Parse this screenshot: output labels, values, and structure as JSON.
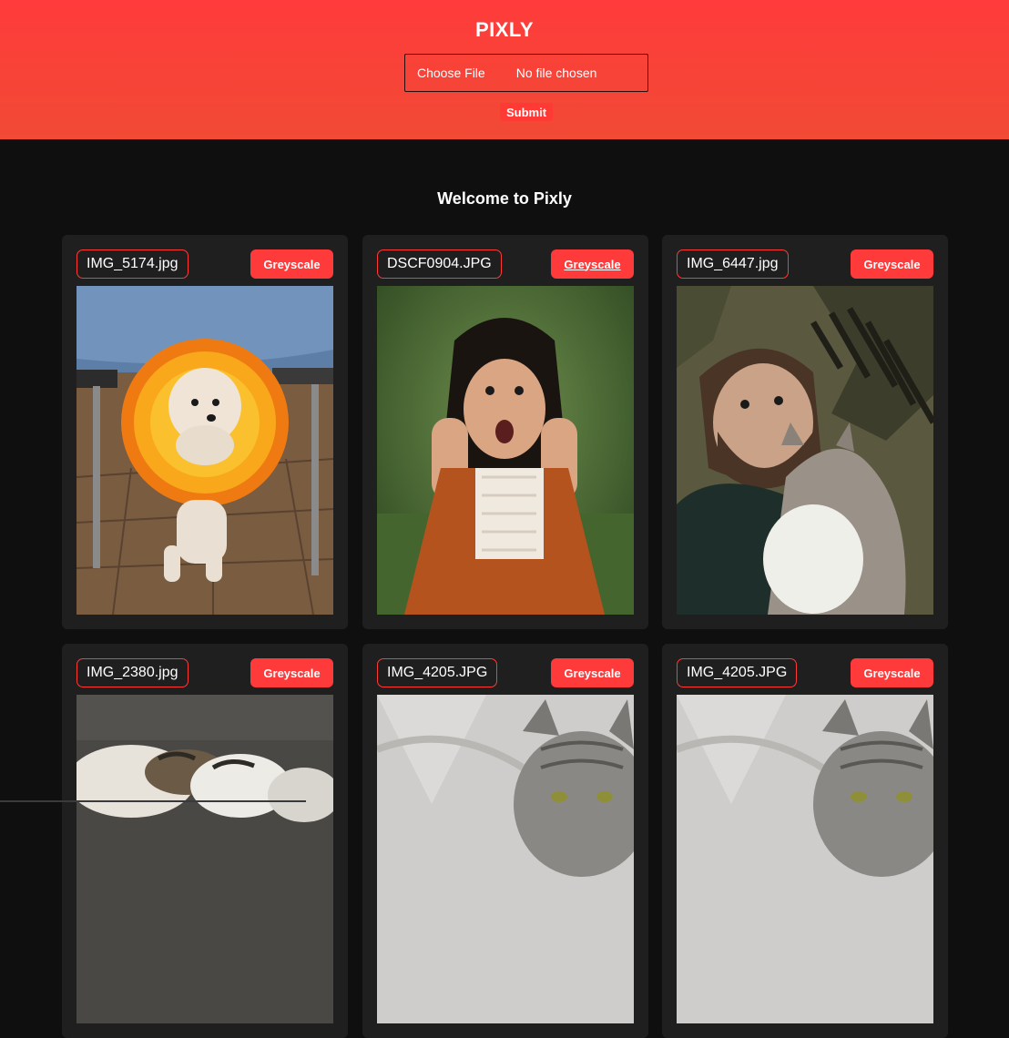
{
  "header": {
    "title": "PIXLY",
    "file_button_label": "Choose File",
    "file_status": "No file chosen",
    "submit_label": "Submit"
  },
  "main": {
    "welcome": "Welcome to Pixly",
    "cards": [
      {
        "file_name": "IMG_5174.jpg",
        "button_label": "Greyscale",
        "image": "poodle-with-flower-cone"
      },
      {
        "file_name": "DSCF0904.JPG",
        "button_label": "Greyscale",
        "image": "surprised-girl-orange-dress"
      },
      {
        "file_name": "IMG_6447.jpg",
        "button_label": "Greyscale",
        "image": "man-with-cat"
      },
      {
        "file_name": "IMG_2380.jpg",
        "button_label": "Greyscale",
        "image": "sleeping-calico-cat"
      },
      {
        "file_name": "IMG_4205.JPG",
        "button_label": "Greyscale",
        "image": "grey-tabby-cat"
      },
      {
        "file_name": "IMG_4205.JPG",
        "button_label": "Greyscale",
        "image": "grey-tabby-cat"
      }
    ]
  },
  "colors": {
    "accent": "#ff3a3a",
    "header_top": "#ff3b3b",
    "header_bottom": "#f14a35",
    "page_bg": "#0f0f10",
    "card_bg": "#1f1f20"
  }
}
